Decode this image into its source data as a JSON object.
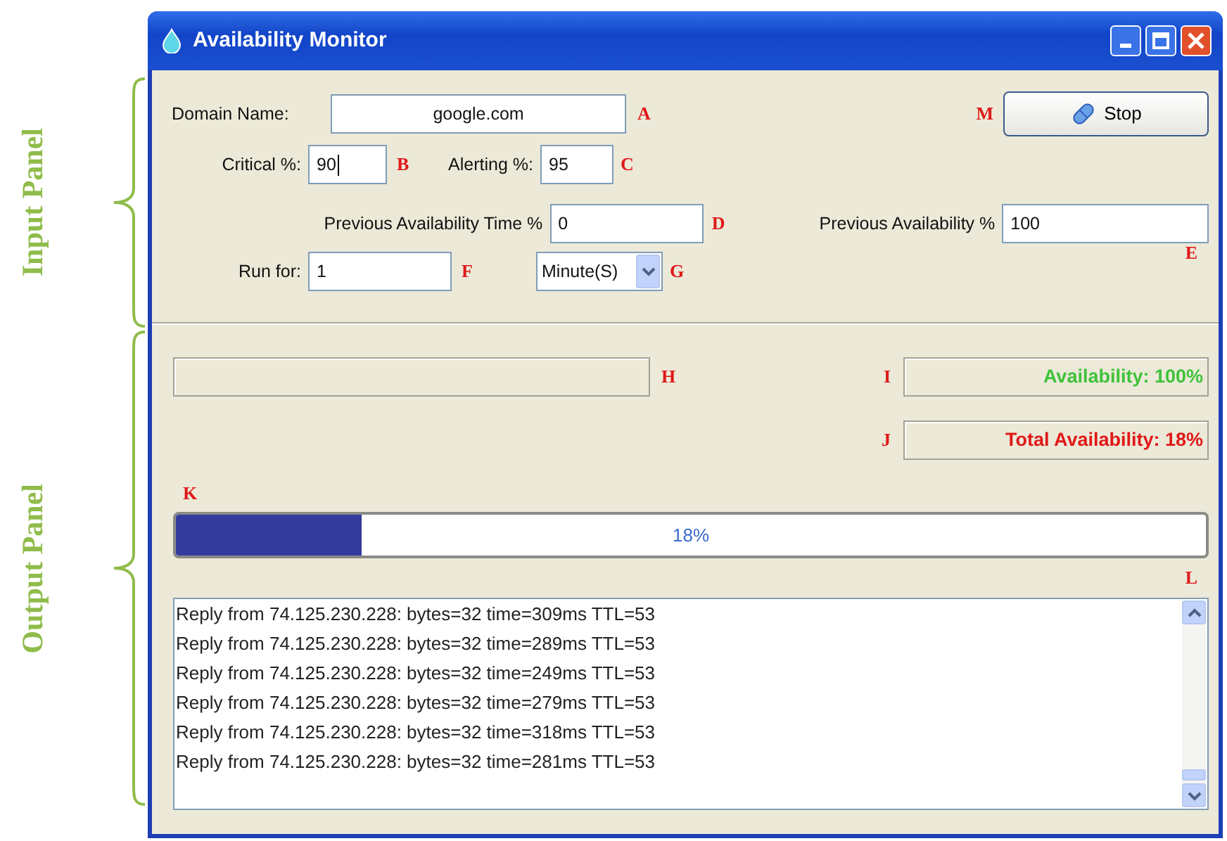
{
  "annotations": [
    {
      "label": "Input Panel"
    },
    {
      "label": "Output Panel"
    }
  ],
  "window": {
    "title": "Availability Monitor"
  },
  "input": {
    "domain": {
      "label": "Domain Name:",
      "value": "google.com",
      "marker": "A"
    },
    "critical": {
      "label": "Critical %:",
      "value": "90",
      "marker": "B",
      "focused": true
    },
    "alerting": {
      "label": "Alerting %:",
      "value": "95",
      "marker": "C",
      "focused": false
    },
    "prev_time": {
      "label": "Previous Availability Time %",
      "value": "0",
      "marker": "D"
    },
    "prev_avail": {
      "label": "Previous Availability %",
      "value": "100",
      "marker": "E"
    },
    "run_for": {
      "label": "Run for:",
      "value": "1",
      "marker": "F"
    },
    "unit": {
      "value": "Minute(S)",
      "marker": "G"
    },
    "stop_button": {
      "label": "Stop",
      "marker": "M"
    }
  },
  "output": {
    "status_field": {
      "marker": "H"
    },
    "availability": {
      "text": "Availability: 100%",
      "marker": "I"
    },
    "total": {
      "text": "Total Availability: 18%",
      "marker": "J"
    },
    "progress": {
      "marker": "K",
      "level": 0.18,
      "text": "18%"
    },
    "log": {
      "marker": "L",
      "lines": [
        "Reply from 74.125.230.228: bytes=32 time=309ms TTL=53",
        "Reply from 74.125.230.228: bytes=32 time=289ms TTL=53",
        "Reply from 74.125.230.228: bytes=32 time=249ms TTL=53",
        "Reply from 74.125.230.228: bytes=32 time=279ms TTL=53",
        "Reply from 74.125.230.228: bytes=32 time=318ms TTL=53",
        "Reply from 74.125.230.228: bytes=32 time=281ms TTL=53"
      ]
    }
  }
}
